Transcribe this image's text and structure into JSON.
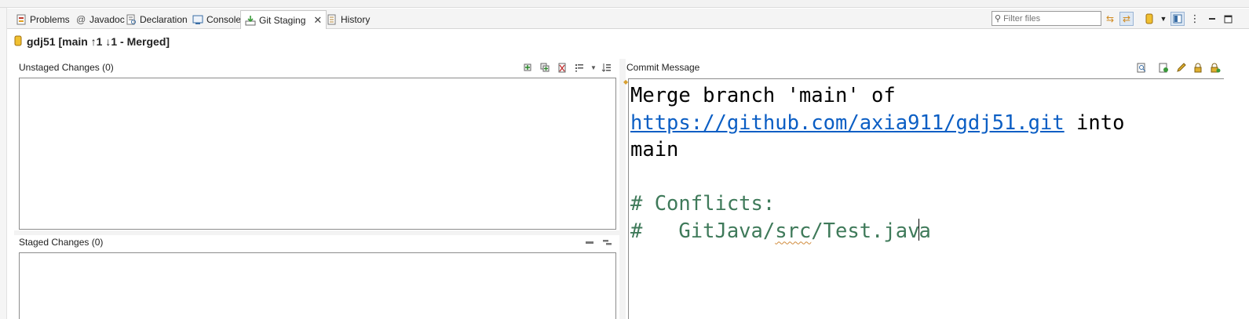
{
  "tabs": [
    {
      "label": "Problems",
      "icon": "problems-icon"
    },
    {
      "label": "Javadoc",
      "icon": "javadoc-icon"
    },
    {
      "label": "Declaration",
      "icon": "declaration-icon"
    },
    {
      "label": "Console",
      "icon": "console-icon"
    },
    {
      "label": "Git Staging",
      "icon": "git-staging-icon",
      "active": true
    },
    {
      "label": "History",
      "icon": "history-icon"
    }
  ],
  "toolbar": {
    "filter_placeholder": "Filter files"
  },
  "repo": {
    "title": "gdj51 [main ↑1 ↓1 - Merged]"
  },
  "unstaged": {
    "header": "Unstaged Changes (0)"
  },
  "staged": {
    "header": "Staged Changes (0)"
  },
  "commit": {
    "header": "Commit Message",
    "line1": "Merge branch 'main' of",
    "link": "https://github.com/axia911/gdj51.git",
    "after_link": " into",
    "line3": "main",
    "conflicts": "# Conflicts:",
    "conflict_prefix": "#   GitJava/",
    "conflict_squiggle": "src",
    "conflict_mid": "/Test.jav",
    "conflict_end": "a"
  },
  "colors": {
    "link": "#0b5ec4",
    "comment": "#3f7a5a",
    "border": "#8c8c8c"
  }
}
